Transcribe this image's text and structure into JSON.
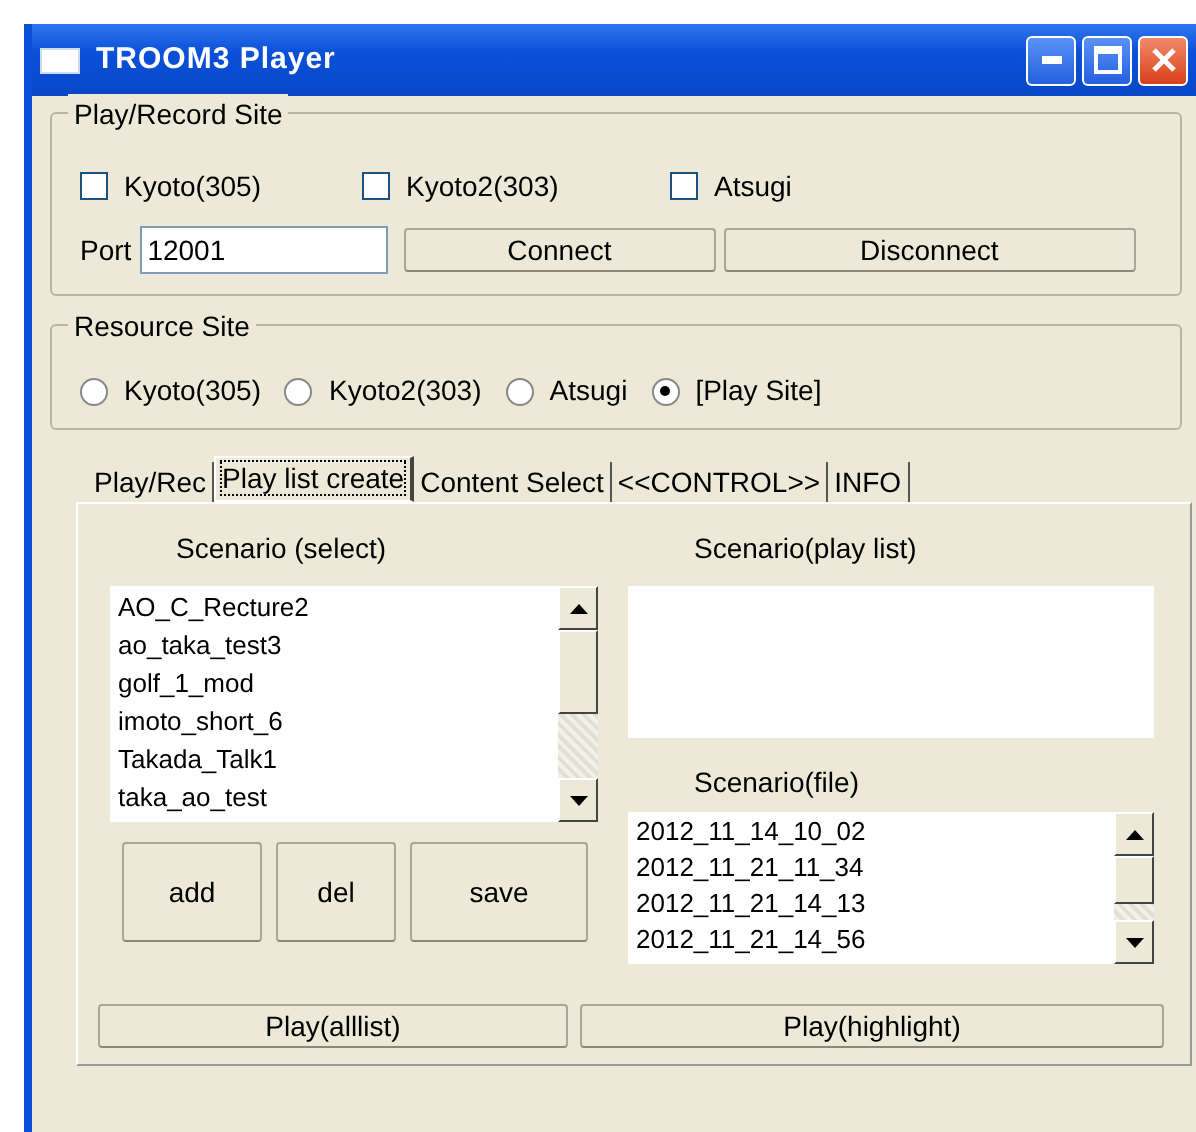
{
  "window": {
    "title": "TROOM3 Player"
  },
  "play_record_site": {
    "title": "Play/Record Site",
    "sites": [
      {
        "label": "Kyoto(305)",
        "checked": false
      },
      {
        "label": "Kyoto2(303)",
        "checked": false
      },
      {
        "label": "Atsugi",
        "checked": false
      }
    ],
    "port_label": "Port",
    "port_value": "12001",
    "buttons": [
      "Connect",
      "Disconnect"
    ]
  },
  "resource_site": {
    "title": "Resource Site",
    "options": [
      {
        "label": "Kyoto(305)",
        "selected": false
      },
      {
        "label": "Kyoto2(303)",
        "selected": false
      },
      {
        "label": "Atsugi",
        "selected": false
      },
      {
        "label": "[Play Site]",
        "selected": true
      }
    ]
  },
  "tabs": [
    {
      "label": "Play/Rec",
      "selected": false
    },
    {
      "label": "Play list create",
      "selected": true
    },
    {
      "label": "Content Select",
      "selected": false
    },
    {
      "label": "<<CONTROL>>",
      "selected": false
    },
    {
      "label": "INFO",
      "selected": false
    }
  ],
  "scenario_select": {
    "label": "Scenario (select)",
    "items": [
      "AO_C_Recture2",
      "ao_taka_test3",
      "golf_1_mod",
      "imoto_short_6",
      "Takada_Talk1",
      "taka_ao_test"
    ]
  },
  "list_buttons": [
    "add",
    "del",
    "save"
  ],
  "scenario_play_list": {
    "label": "Scenario(play list)"
  },
  "scenario_file": {
    "label": "Scenario(file)",
    "items": [
      "2012_11_14_10_02",
      "2012_11_21_11_34",
      "2012_11_21_14_13",
      "2012_11_21_14_56"
    ]
  },
  "play_buttons": [
    "Play(alllist)",
    "Play(highlight)"
  ]
}
